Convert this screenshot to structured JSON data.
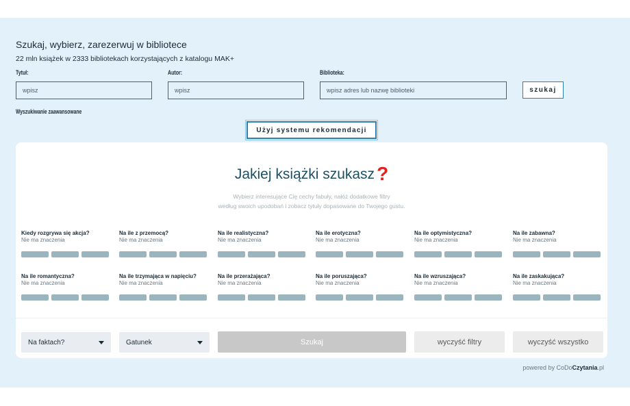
{
  "header": {
    "title": "Szukaj, wybierz, zarezerwuj w bibliotece",
    "subtitle": "22 mln książek w 2333 bibliotekach korzystających z katalogu MAK+"
  },
  "search": {
    "title_label": "Tytuł:",
    "title_placeholder": "wpisz",
    "author_label": "Autor:",
    "author_placeholder": "wpisz",
    "library_label": "Biblioteka:",
    "library_placeholder": "wpisz adres lub nazwę biblioteki",
    "search_button": "szukaj",
    "advanced_link": "Wyszukiwanie zaawansowane",
    "recommend_button": "Użyj systemu rekomendacji"
  },
  "recommender": {
    "title": "Jakiej książki szukasz",
    "title_mark": "?",
    "desc_line1": "Wybierz interesujące Cię cechy fabuły, nałóż dodatkowe filtry",
    "desc_line2": "według swoich upodobań i zobacz tytuły dopasowane do Twojego gustu.",
    "filters": [
      {
        "question": "Kiedy rozgrywa się akcja?",
        "value": "Nie ma znaczenia"
      },
      {
        "question": "Na ile z przemocą?",
        "value": "Nie ma znaczenia"
      },
      {
        "question": "Na ile realistyczna?",
        "value": "Nie ma znaczenia"
      },
      {
        "question": "Na ile erotyczna?",
        "value": "Nie ma znaczenia"
      },
      {
        "question": "Na ile optymistyczna?",
        "value": "Nie ma znaczenia"
      },
      {
        "question": "Na ile zabawna?",
        "value": "Nie ma znaczenia"
      },
      {
        "question": "Na ile romantyczna?",
        "value": "Nie ma znaczenia"
      },
      {
        "question": "Na ile trzymająca w napięciu?",
        "value": "Nie ma znaczenia"
      },
      {
        "question": "Na ile przerażająca?",
        "value": "Nie ma znaczenia"
      },
      {
        "question": "Na ile poruszająca?",
        "value": "Nie ma znaczenia"
      },
      {
        "question": "Na ile wzruszająca?",
        "value": "Nie ma znaczenia"
      },
      {
        "question": "Na ile zaskakująca?",
        "value": "Nie ma znaczenia"
      }
    ],
    "facts_select": "Na faktach?",
    "genre_select": "Gatunek",
    "search_button": "Szukaj",
    "clear_filters": "wyczyść filtry",
    "clear_all": "wyczyść wszystko"
  },
  "footer": {
    "powered_prefix": "powered by ",
    "brand_part1": "CoDo",
    "brand_part2": "Czytania",
    "brand_suffix": ".pl"
  },
  "colors": {
    "banner_bg": "#e3f1fa",
    "accent_blue": "#2c7fb0",
    "title_teal": "#1d4f63",
    "question_red": "#e32222",
    "segment": "#9bb5bf"
  }
}
